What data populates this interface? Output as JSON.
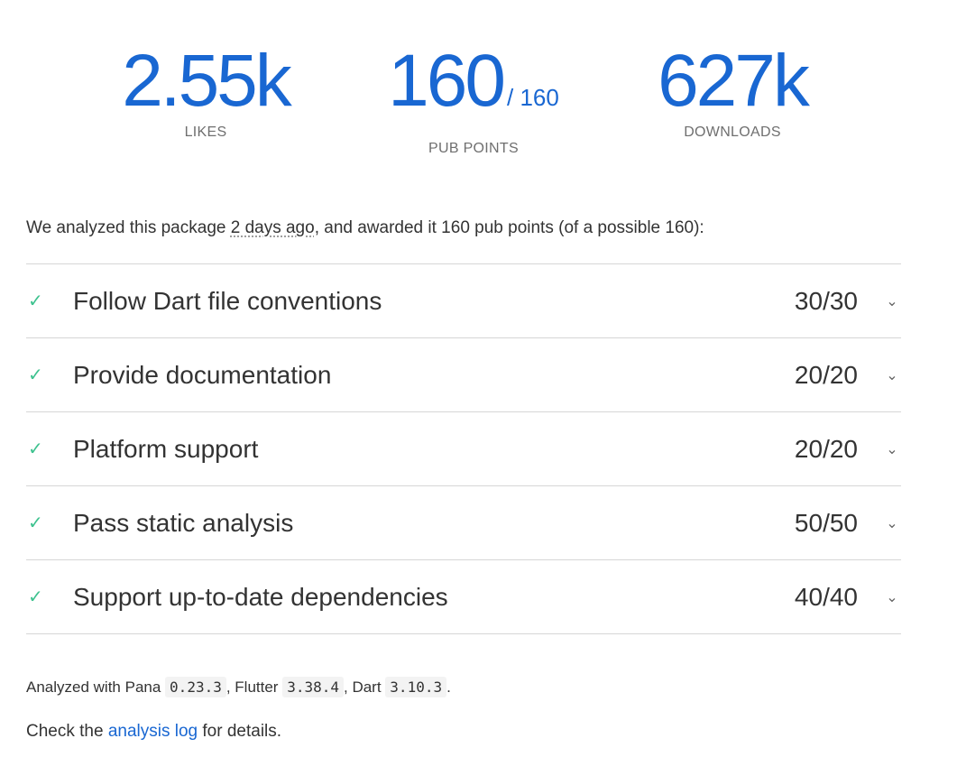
{
  "stats": {
    "likes": {
      "value": "2.55k",
      "label": "LIKES"
    },
    "points": {
      "value": "160",
      "max": "/ 160",
      "label": "PUB POINTS"
    },
    "downloads": {
      "value": "627k",
      "label": "DOWNLOADS"
    }
  },
  "intro": {
    "prefix": "We analyzed this package ",
    "ago": "2 days ago",
    "suffix": ", and awarded it 160 pub points (of a possible 160):"
  },
  "sections": [
    {
      "title": "Follow Dart file conventions",
      "score": "30/30"
    },
    {
      "title": "Provide documentation",
      "score": "20/20"
    },
    {
      "title": "Platform support",
      "score": "20/20"
    },
    {
      "title": "Pass static analysis",
      "score": "50/50"
    },
    {
      "title": "Support up-to-date dependencies",
      "score": "40/40"
    }
  ],
  "analyzed": {
    "t1": "Analyzed with Pana ",
    "pana": "0.23.3",
    "t2": ", Flutter ",
    "flutter": "3.38.4",
    "t3": ", Dart ",
    "dart": "3.10.3",
    "t4": "."
  },
  "details": {
    "prefix": "Check the ",
    "link": "analysis log",
    "suffix": " for details."
  },
  "icons": {
    "check": "check-icon",
    "expand": "chevron-down-icon"
  },
  "colors": {
    "accent": "#1967d2",
    "check": "#3ec28f"
  }
}
